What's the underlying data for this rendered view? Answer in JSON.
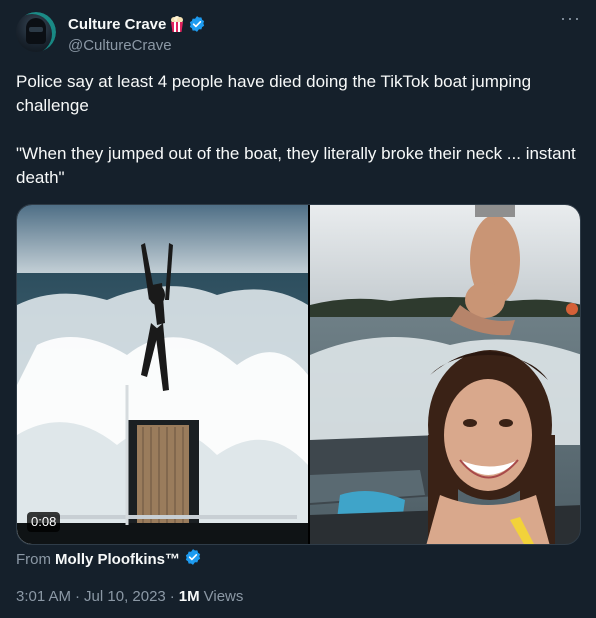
{
  "author": {
    "display_name": "Culture Crave",
    "handle": "@CultureCrave",
    "badge_icon": "popcorn-icon",
    "verified_icon": "verified-badge-icon",
    "verified_color": "#1d9bf0"
  },
  "more_icon": "more-options-icon",
  "tweet": {
    "text": "Police say at least 4 people have died doing the TikTok boat jumping challenge\n\n\"When they jumped out of the boat, they literally broke their neck ... instant death\""
  },
  "media": {
    "duration": "0:08"
  },
  "attribution": {
    "prefix": "From",
    "name": "Molly Ploofkins™"
  },
  "meta": {
    "time": "3:01 AM",
    "separator1": "·",
    "date": "Jul 10, 2023",
    "separator2": "·",
    "views_count": "1M",
    "views_label": "Views"
  },
  "colors": {
    "background": "#15202b",
    "primary_text": "#f7f9f9",
    "secondary_text": "#8b98a5",
    "accent": "#1d9bf0"
  }
}
